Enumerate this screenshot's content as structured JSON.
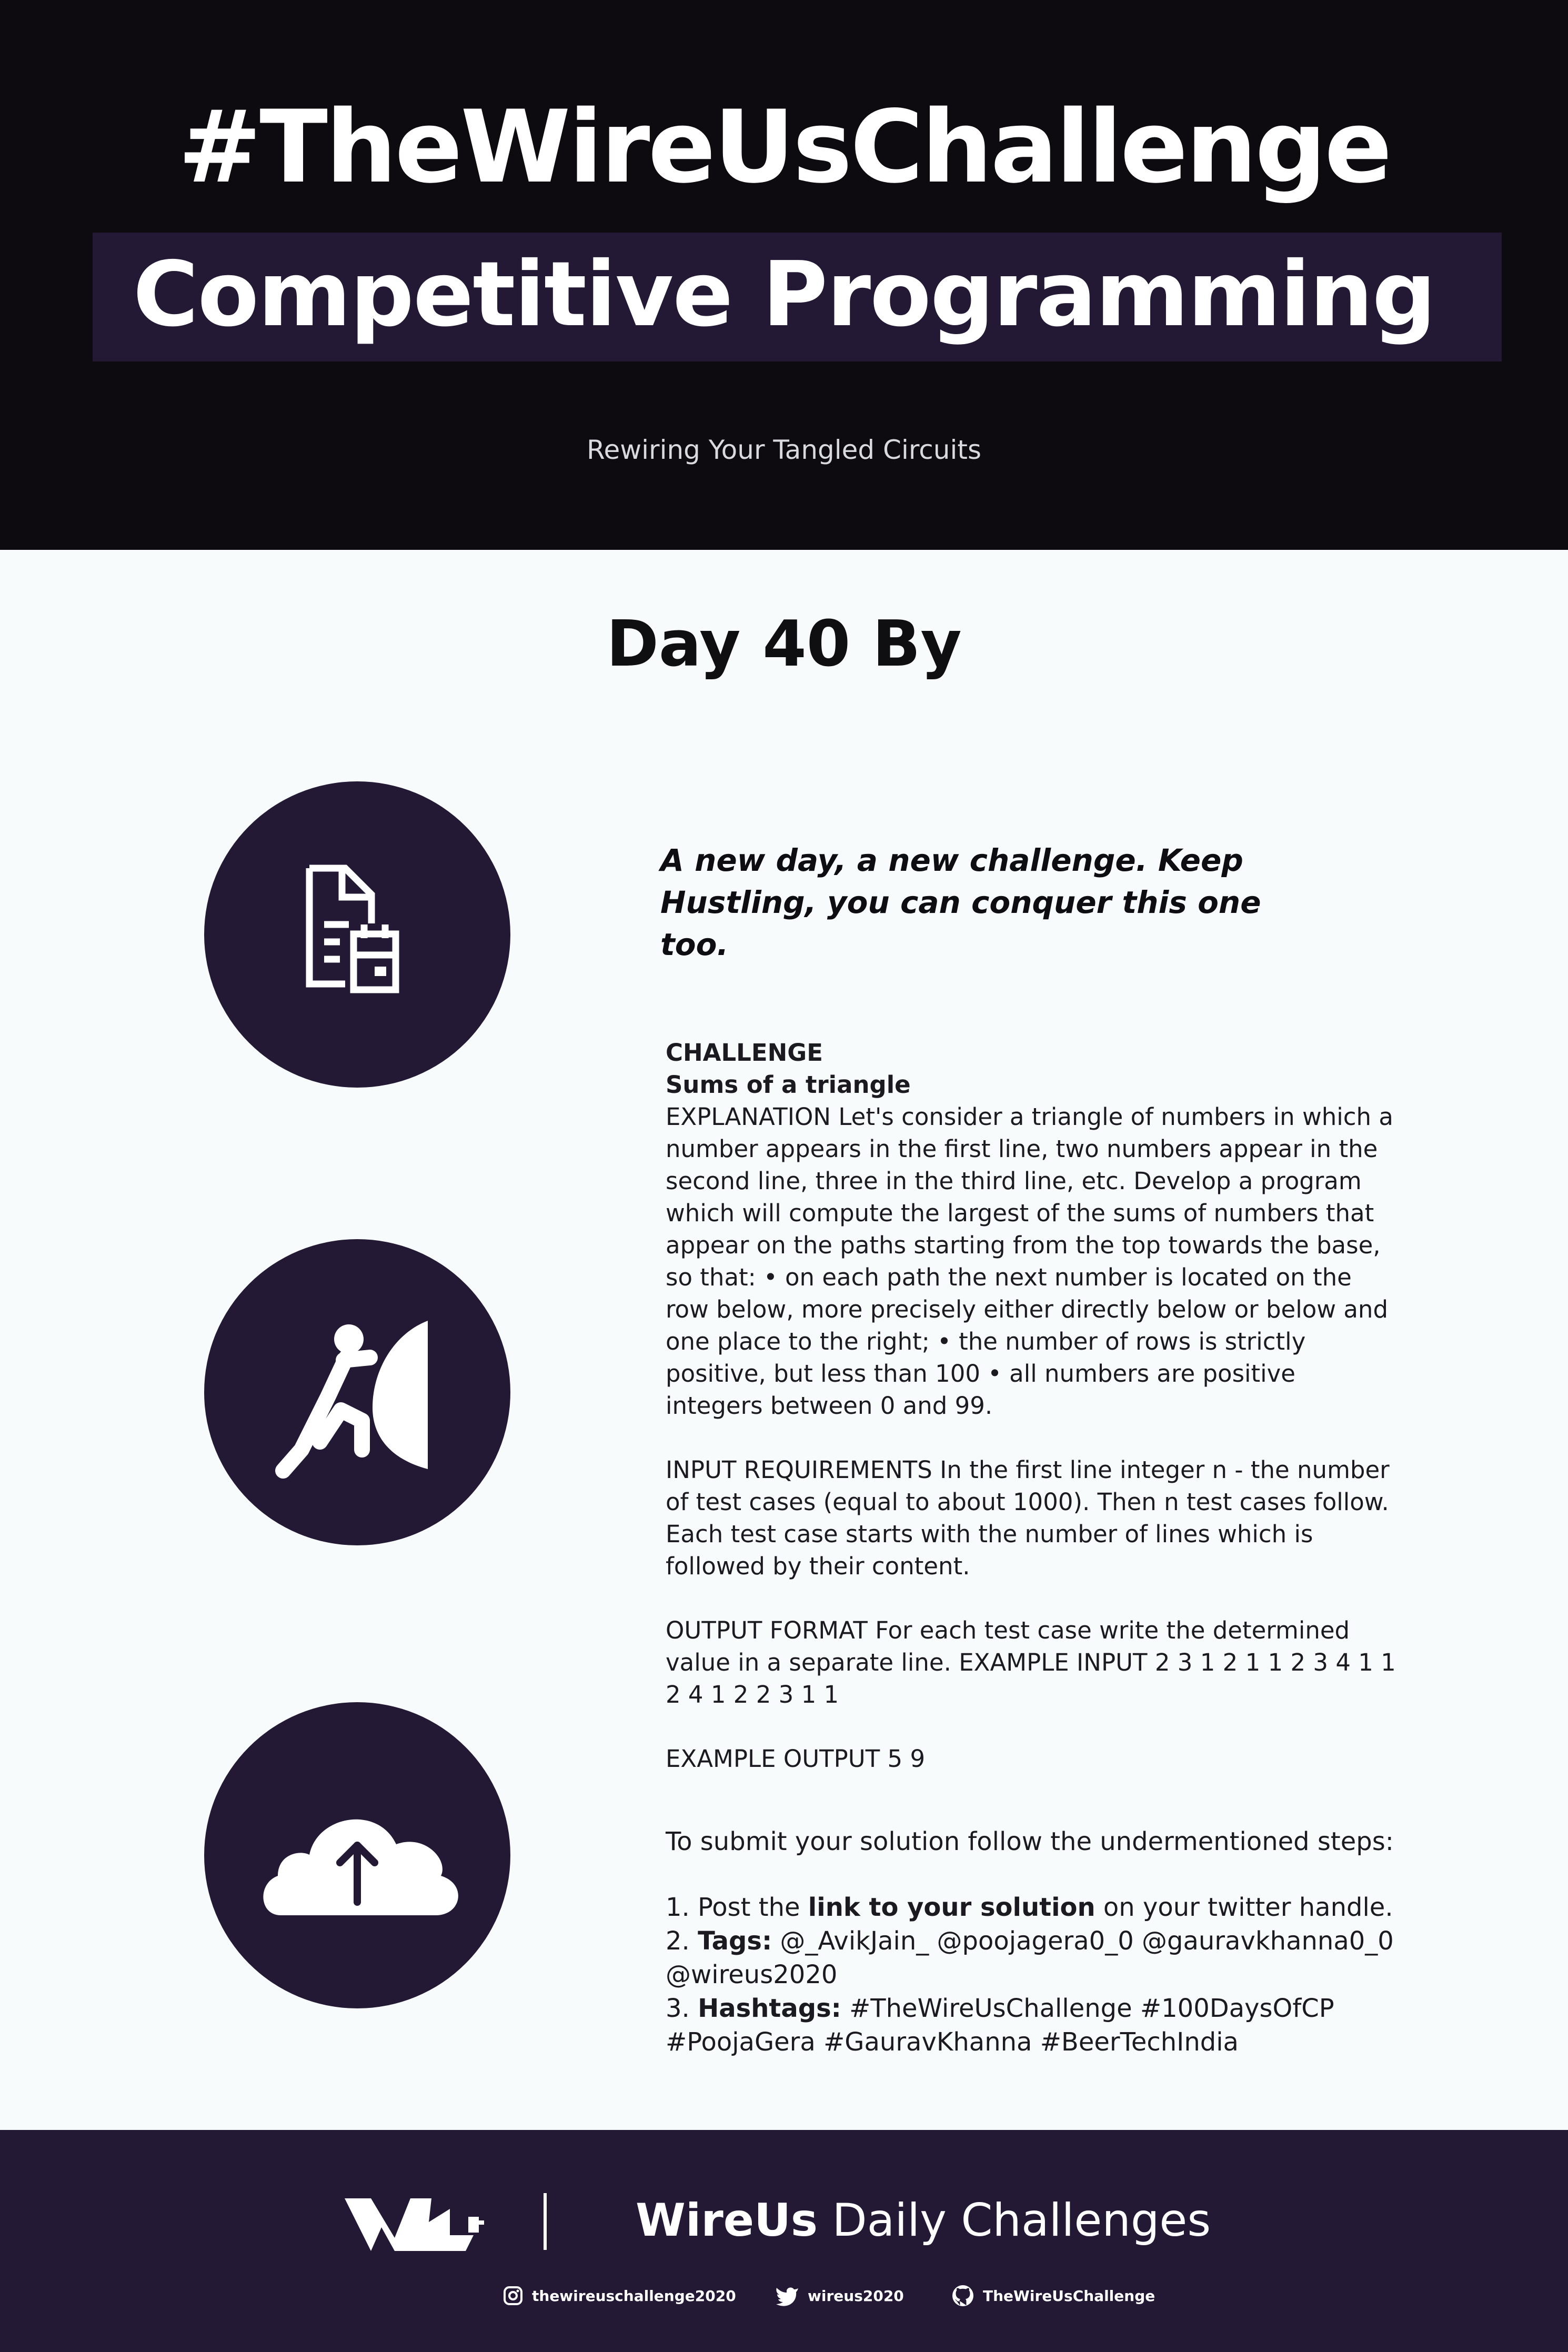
{
  "header": {
    "hashtag_title": "#TheWireUsChallenge",
    "subtitle": "Competitive Programming",
    "tagline": "Rewiring Your Tangled Circuits"
  },
  "day_title": "Day 40 By",
  "quote": "A new day, a new challenge. Keep Hustling, you can conquer this one too.",
  "challenge": {
    "heading": "CHALLENGE",
    "name": "Sums of a triangle",
    "explanation": "EXPLANATION Let's consider a triangle of numbers in which a number appears in the first line, two numbers appear in the second line, three in the third line, etc. Develop a program which will compute the largest of the sums of numbers that appear on the paths starting from the top towards the base, so that: • on each path the next number is located on the row below, more precisely either directly below or below and one place to the right; • the number of rows is strictly positive, but less than 100 • all numbers are positive integers between 0 and 99.",
    "input": "INPUT REQUIREMENTS In the first line integer n - the number of test cases (equal to about 1000). Then n test cases follow. Each test case starts with the number of lines which is followed by their content.",
    "output": "OUTPUT FORMAT For each test case write the determined value in a separate line. EXAMPLE INPUT 2 3 1 2 1 1 2 3 4 1 1 2 4 1 2 2 3 1 1",
    "example_output": "EXAMPLE OUTPUT 5 9"
  },
  "submit": {
    "intro": "To submit your solution follow the undermentioned steps:",
    "step1_prefix": "1. Post the ",
    "step1_bold": "link to your solution",
    "step1_suffix": " on your twitter handle.",
    "step2_prefix": "2. ",
    "step2_bold": "Tags:",
    "step2_text": " @_AvikJain_ @poojagera0_0 @gauravkhanna0_0 @wireus2020",
    "step3_prefix": "3. ",
    "step3_bold": "Hashtags:",
    "step3_text": " #TheWireUsChallenge #100DaysOfCP #PoojaGera #GauravKhanna #BeerTechIndia"
  },
  "icons": {
    "icon1": "document-calendar-icon",
    "icon2": "person-pushing-icon",
    "icon3": "cloud-upload-icon"
  },
  "footer": {
    "brand_bold": "WireUs",
    "brand_rest": " Daily Challenges",
    "instagram": "thewireuschallenge2020",
    "twitter": "wireus2020",
    "github": "TheWireUsChallenge"
  },
  "colors": {
    "dark_header": "#0d0b10",
    "accent_purple": "#231935",
    "page_bg": "#f7fbfb"
  }
}
